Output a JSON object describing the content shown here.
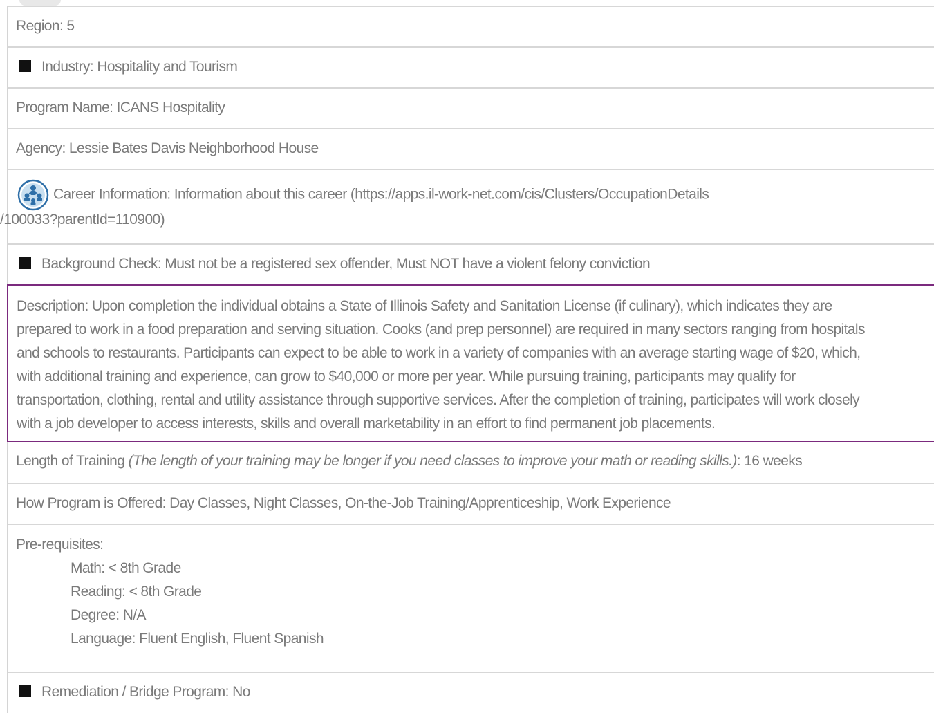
{
  "rows": {
    "region": "Region: 5",
    "industry": "Industry: Hospitality and Tourism",
    "program_name": "Program Name: ICANS Hospitality",
    "agency": "Agency: Lessie Bates Davis Neighborhood House",
    "career_info_line1": "Career Information: Information about this career (https://apps.il-work-net.com/cis/Clusters/OccupationDetails",
    "career_info_line2": "/100033?parentId=110900)",
    "background_check": "Background Check: Must not be a registered sex offender, Must NOT have a violent felony conviction",
    "description_lines": [
      "Description: Upon completion the individual obtains a State of Illinois Safety and Sanitation License (if culinary), which indicates they are",
      "prepared to work in a food preparation and serving situation. Cooks (and prep personnel) are required in many sectors ranging from hospitals",
      "and schools to restaurants. Participants can expect to be able to work in a variety of companies with an average starting wage of $20, which,",
      "with additional training and experience, can grow to $40,000 or more per year. While pursuing training, participants may qualify for",
      "transportation, clothing, rental and utility assistance through supportive services. After the completion of training, participates will work closely",
      "with a job developer to access interests, skills and overall marketability in an effort to find permanent job placements."
    ],
    "length_label": "Length of Training ",
    "length_note": "(The length of your training may be longer if you need classes to improve your math or reading skills.)",
    "length_value": ": 16 weeks",
    "offered": "How Program is Offered: Day Classes, Night Classes, On-the-Job Training/Apprenticeship, Work Experience",
    "prereq_label": "Pre-requisites:",
    "prereq_math": "Math: < 8th Grade",
    "prereq_reading": "Reading: < 8th Grade",
    "prereq_degree": "Degree: N/A",
    "prereq_language": "Language: Fluent English, Fluent Spanish",
    "remediation": "Remediation / Bridge Program: No"
  },
  "icons": {
    "bullet": "black-square-icon",
    "career": "career-cluster-icon"
  },
  "colors": {
    "text": "#7a7a7a",
    "border": "#d7d7d7",
    "highlight_border": "#7b2a7e",
    "icon_blue": "#2e6fa8"
  }
}
